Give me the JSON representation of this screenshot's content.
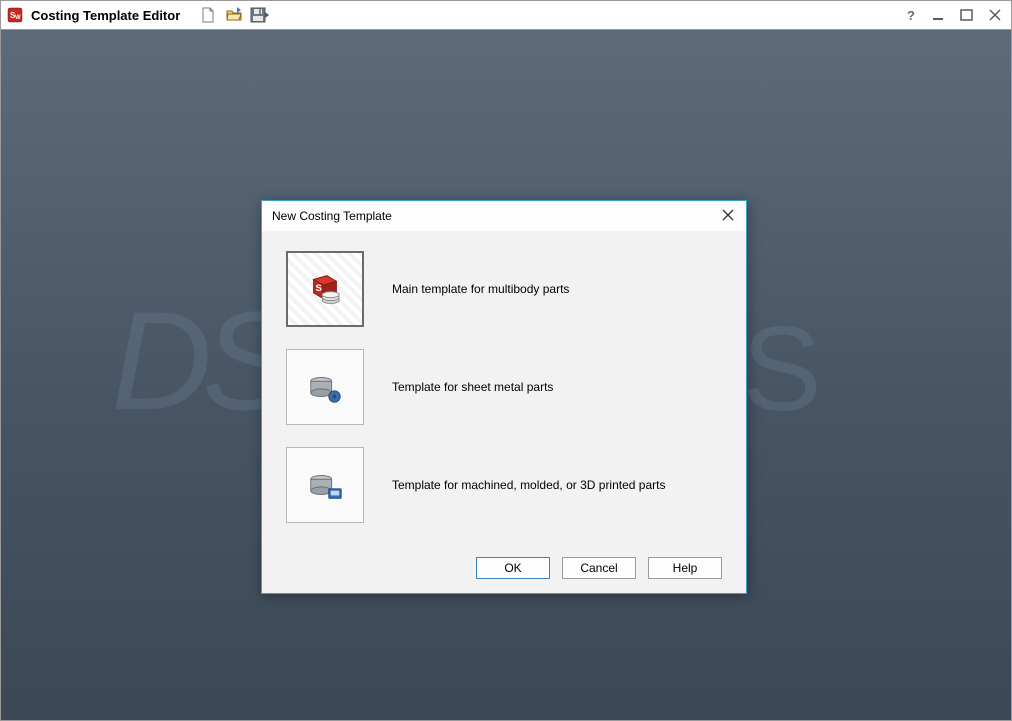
{
  "window": {
    "title": "Costing Template Editor"
  },
  "toolbar": {
    "new_tooltip": "New",
    "open_tooltip": "Open",
    "save_tooltip": "Save"
  },
  "dialog": {
    "title": "New Costing Template",
    "options": [
      {
        "label": "Main template for multibody parts"
      },
      {
        "label": "Template for sheet metal parts"
      },
      {
        "label": "Template for machined, molded, or 3D printed parts"
      }
    ],
    "buttons": {
      "ok": "OK",
      "cancel": "Cancel",
      "help": "Help"
    }
  },
  "background_logo": {
    "left_fragment": "DS",
    "right_fragment": "RKS"
  }
}
